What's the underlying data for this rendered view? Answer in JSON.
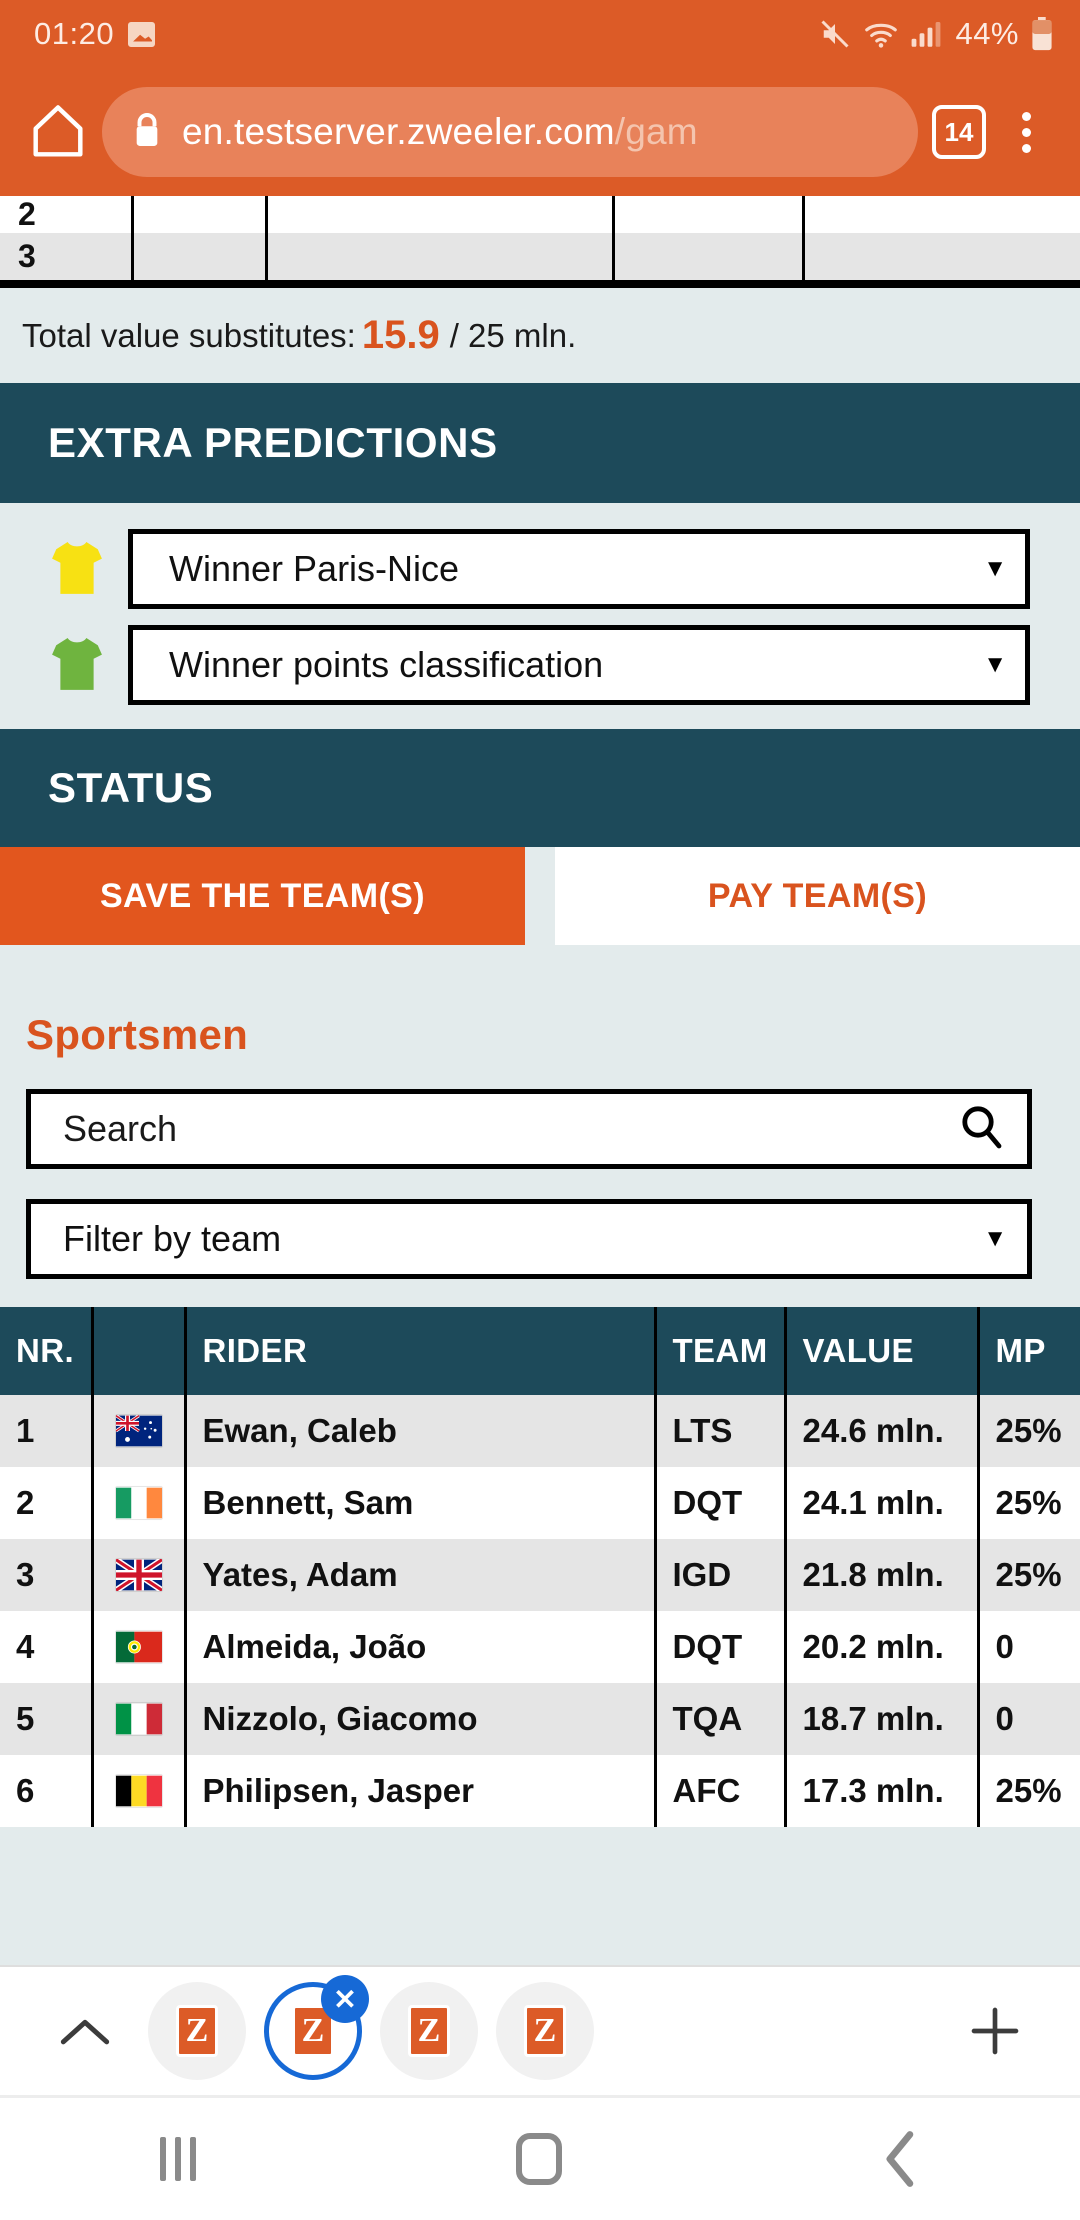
{
  "statusbar": {
    "time": "01:20",
    "image_icon": "image-icon",
    "mute_icon": "mute-icon",
    "wifi_icon": "wifi-icon",
    "signal_icon": "cellular-signal-icon",
    "battery_percent": "44%",
    "battery_icon": "battery-icon"
  },
  "browser": {
    "home_icon": "home-icon",
    "lock_icon": "lock-icon",
    "url_main": "en.testserver.zweeler.com",
    "url_path": "/gam",
    "tab_count": "14",
    "menu_icon": "kebab-menu-icon"
  },
  "top_table": {
    "partial_row_nr": "2",
    "row_nr": "3",
    "cells": [
      "",
      "",
      "",
      ""
    ]
  },
  "total_value": {
    "label": "Total value substitutes:",
    "amount": "15.9",
    "limit": "/ 25 mln."
  },
  "extra_predictions": {
    "heading": "EXTRA PREDICTIONS",
    "rows": [
      {
        "jersey": "yellow-jersey-icon",
        "jersey_color": "#F7E113",
        "value": "Winner Paris-Nice",
        "caret": "▼"
      },
      {
        "jersey": "green-jersey-icon",
        "jersey_color": "#6FB43F",
        "value": "Winner points classification",
        "caret": "▼"
      }
    ]
  },
  "status_section": {
    "heading": "STATUS",
    "save_button": "SAVE THE TEAM(S)",
    "pay_button": "PAY TEAM(S)"
  },
  "sportsmen": {
    "title": "Sportsmen",
    "search_placeholder": "Search",
    "search_icon": "search-icon",
    "filter_value": "Filter by team",
    "filter_caret": "▼",
    "columns": [
      "NR.",
      "",
      "RIDER",
      "TEAM",
      "VALUE",
      "MP"
    ],
    "rows": [
      {
        "nr": "1",
        "flag": "flag-australia",
        "rider": "Ewan, Caleb",
        "team": "LTS",
        "value": "24.6 mln.",
        "mp": "25%"
      },
      {
        "nr": "2",
        "flag": "flag-ireland",
        "rider": "Bennett, Sam",
        "team": "DQT",
        "value": "24.1 mln.",
        "mp": "25%"
      },
      {
        "nr": "3",
        "flag": "flag-united-kingdom",
        "rider": "Yates, Adam",
        "team": "IGD",
        "value": "21.8 mln.",
        "mp": "25%"
      },
      {
        "nr": "4",
        "flag": "flag-portugal",
        "rider": "Almeida, João",
        "team": "DQT",
        "value": "20.2 mln.",
        "mp": "0"
      },
      {
        "nr": "5",
        "flag": "flag-italy",
        "rider": "Nizzolo, Giacomo",
        "team": "TQA",
        "value": "18.7 mln.",
        "mp": "0"
      },
      {
        "nr": "6",
        "flag": "flag-belgium",
        "rider": "Philipsen, Jasper",
        "team": "AFC",
        "value": "17.3 mln.",
        "mp": "25%"
      }
    ]
  },
  "tabstrip": {
    "collapse_icon": "chevron-up-icon",
    "tabs": [
      {
        "favicon_letter": "Z",
        "selected": false
      },
      {
        "favicon_letter": "Z",
        "selected": true,
        "close_label": "✕"
      },
      {
        "favicon_letter": "Z",
        "selected": false
      },
      {
        "favicon_letter": "Z",
        "selected": false
      }
    ],
    "new_tab_icon": "plus-icon"
  },
  "navbar": {
    "recents_icon": "recents-icon",
    "home_icon": "home-square-icon",
    "back_icon": "back-chevron-icon"
  },
  "colors": {
    "accent_orange": "#DC5B27",
    "header_teal": "#1D4A5A",
    "page_bg": "#E3EBEC",
    "link_blue": "#1669D6"
  }
}
